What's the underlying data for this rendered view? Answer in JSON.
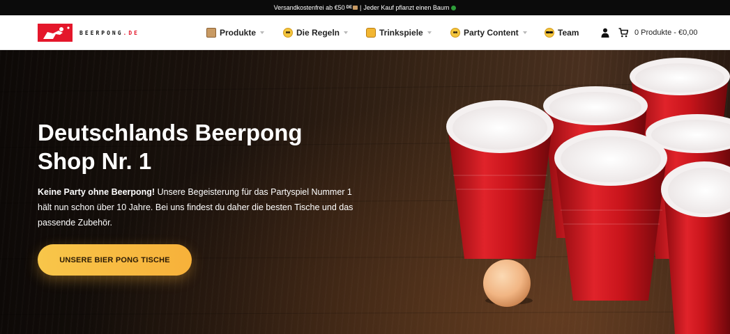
{
  "topbar": {
    "shipping": "Versandkostenfrei ab €50",
    "shipping_flag": "DE",
    "separator": "|",
    "tree_note": "Jeder Kauf pflanzt einen Baum"
  },
  "logo": {
    "name": "BEERPONG",
    "tld": ".DE"
  },
  "nav": {
    "items": [
      {
        "label": "Produkte",
        "icon": "package-emoji-icon",
        "dropdown": true
      },
      {
        "label": "Die Regeln",
        "icon": "nerd-face-emoji-icon",
        "dropdown": true
      },
      {
        "label": "Trinkspiele",
        "icon": "beer-emoji-icon",
        "dropdown": true
      },
      {
        "label": "Party Content",
        "icon": "party-face-emoji-icon",
        "dropdown": true
      },
      {
        "label": "Team",
        "icon": "sunglasses-face-emoji-icon",
        "dropdown": false
      }
    ],
    "account_icon": "user-icon",
    "cart_icon": "cart-icon",
    "cart_text": "0 Produkte - €0,00"
  },
  "hero": {
    "title": "Deutschlands Beerpong Shop Nr. 1",
    "intro_bold": "Keine Party ohne Beerpong!",
    "intro_text": " Unsere Begeisterung für das Partyspiel Nummer 1 hält nun schon über 10 Jahre. Bei uns findest du daher die besten Tische und das passende Zubehör.",
    "cta_label": "UNSERE BIER PONG TISCHE"
  },
  "colors": {
    "brand_red": "#e4172b",
    "cta_yellow": "#f8c64a",
    "cup_red": "#d2141c"
  }
}
